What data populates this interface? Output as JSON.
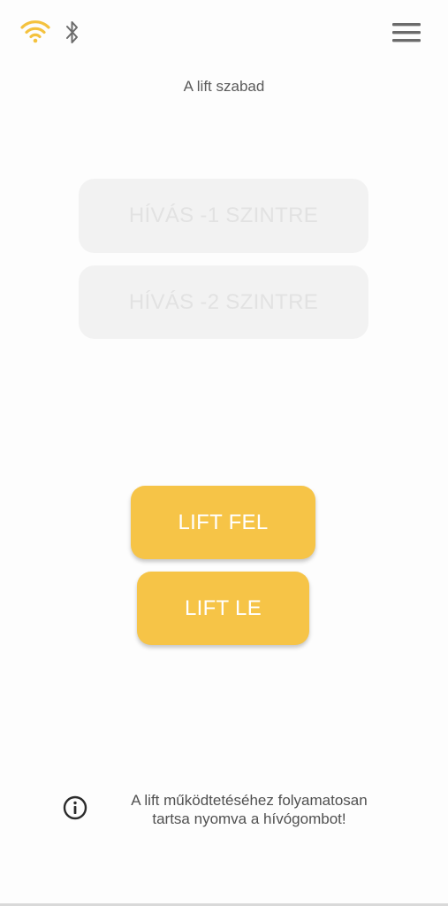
{
  "header": {
    "wifi_icon": "wifi-icon",
    "bluetooth_icon": "bluetooth-icon",
    "menu_icon": "menu-icon",
    "wifi_color": "#f4c23e",
    "icon_color": "#6b6b6b"
  },
  "status": {
    "text": "A lift szabad"
  },
  "call_buttons": {
    "level_minus_1": "HÍVÁS  -1 SZINTRE",
    "level_minus_2": "HÍVÁS  -2 SZINTRE",
    "disabled_color": "#f2f2f2"
  },
  "controls": {
    "up_label": "LIFT FEL",
    "down_label": "LIFT LE",
    "accent_color": "#f6c447"
  },
  "info": {
    "icon": "info-icon",
    "line1": "A lift működtetéséhez folyamatosan",
    "line2": "tartsa nyomva a hívógombot!"
  }
}
